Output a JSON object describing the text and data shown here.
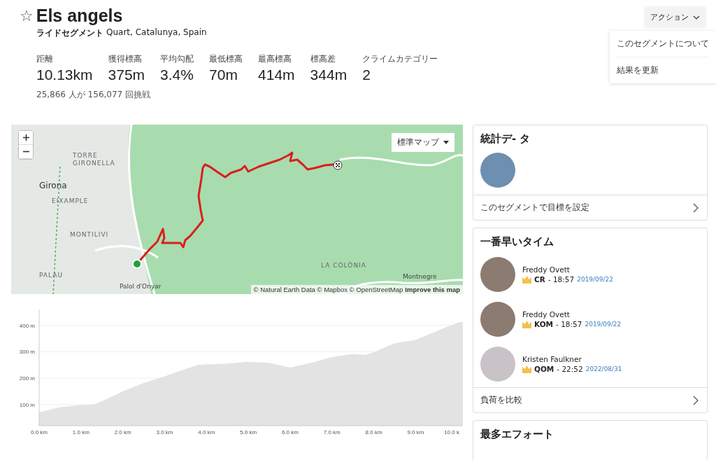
{
  "header": {
    "star": "☆",
    "starred": false,
    "title": "Els angels",
    "segment_type": "ライドセグメント",
    "location": "Quart, Catalunya, Spain"
  },
  "stats": [
    {
      "label": "距離",
      "value": "10.13km"
    },
    {
      "label": "獲得標高",
      "value": "375m"
    },
    {
      "label": "平均勾配",
      "value": "3.4%"
    },
    {
      "label": "最低標高",
      "value": "70m"
    },
    {
      "label": "最高標高",
      "value": "414m"
    },
    {
      "label": "標高差",
      "value": "344m"
    },
    {
      "label": "クライムカテゴリー",
      "value": "2"
    }
  ],
  "attempts": "25,866 人が 156,077 回挑戦",
  "actions": {
    "label": "アクション",
    "expanded": true,
    "items": [
      "このセグメントについて",
      "結果を更新"
    ]
  },
  "map": {
    "map_type": "標準マップ",
    "labels": [
      {
        "text": "TORRE",
        "kind": "district"
      },
      {
        "text": "GIRONELLA",
        "kind": "district"
      },
      {
        "text": "Girona",
        "kind": "city"
      },
      {
        "text": "EIXAMPLE",
        "kind": "district"
      },
      {
        "text": "MONTILIVI",
        "kind": "district"
      },
      {
        "text": "PALAU",
        "kind": "district"
      },
      {
        "text": "Palol d'Onyar",
        "kind": "town"
      },
      {
        "text": "LA COLÒNIA",
        "kind": "district"
      },
      {
        "text": "Montnegre",
        "kind": "town"
      }
    ],
    "attribution": "© Natural Earth Data © Mapbox © OpenStreetMap",
    "improve_link": "Improve this map"
  },
  "elevation": {
    "chart_data": {
      "type": "area",
      "x": [
        0,
        0.5,
        1.0,
        1.3,
        1.5,
        2.0,
        2.5,
        3.0,
        3.5,
        3.8,
        4.0,
        4.5,
        5.0,
        5.5,
        6.0,
        6.5,
        7.0,
        7.5,
        7.8,
        8.0,
        8.5,
        9.0,
        9.5,
        10.0,
        10.13
      ],
      "grid": true,
      "series": [
        {
          "color": "#e3e3e3",
          "values": [
            70,
            90,
            98,
            100,
            112,
            150,
            182,
            207,
            235,
            250,
            252,
            255,
            262,
            258,
            240,
            258,
            280,
            292,
            288,
            298,
            332,
            345,
            378,
            410,
            414
          ]
        }
      ],
      "xlim": [
        0,
        10.13
      ],
      "ylim": [
        20,
        460
      ],
      "xticks": [
        {
          "value": 0,
          "label": "0.0 km"
        },
        {
          "value": 1,
          "label": "1.0 km"
        },
        {
          "value": 2,
          "label": "2.0 km"
        },
        {
          "value": 3,
          "label": "3.0 km"
        },
        {
          "value": 4,
          "label": "4.0 km"
        },
        {
          "value": 5,
          "label": "5.0 km"
        },
        {
          "value": 6,
          "label": "6.0 km"
        },
        {
          "value": 7,
          "label": "7.0 km"
        },
        {
          "value": 8,
          "label": "8.0 km"
        },
        {
          "value": 9,
          "label": "9.0 km"
        },
        {
          "value": 10,
          "label": "10.0 k"
        }
      ],
      "yticks": [
        {
          "value": 100,
          "label": "100 m"
        },
        {
          "value": 200,
          "label": "200 m"
        },
        {
          "value": 300,
          "label": "300 m"
        },
        {
          "value": 400,
          "label": "400 m"
        }
      ]
    }
  },
  "stats_card": {
    "title": "統計デ- タ",
    "goal_link": "このセグメントで目標を設定"
  },
  "fastest": {
    "title": "一番早いタイム",
    "entries": [
      {
        "name": "Freddy Ovett",
        "badge": "CR",
        "time": "- 18:57",
        "date": "2019/09/22"
      },
      {
        "name": "Freddy Ovett",
        "badge": "KOM",
        "time": "- 18:57",
        "date": "2019/09/22"
      },
      {
        "name": "Kristen Faulkner",
        "badge": "QOM",
        "time": "- 22:52",
        "date": "2022/08/31"
      }
    ],
    "compare_link": "負荷を比較"
  },
  "most_efforts": {
    "title": "最多エフォート"
  }
}
